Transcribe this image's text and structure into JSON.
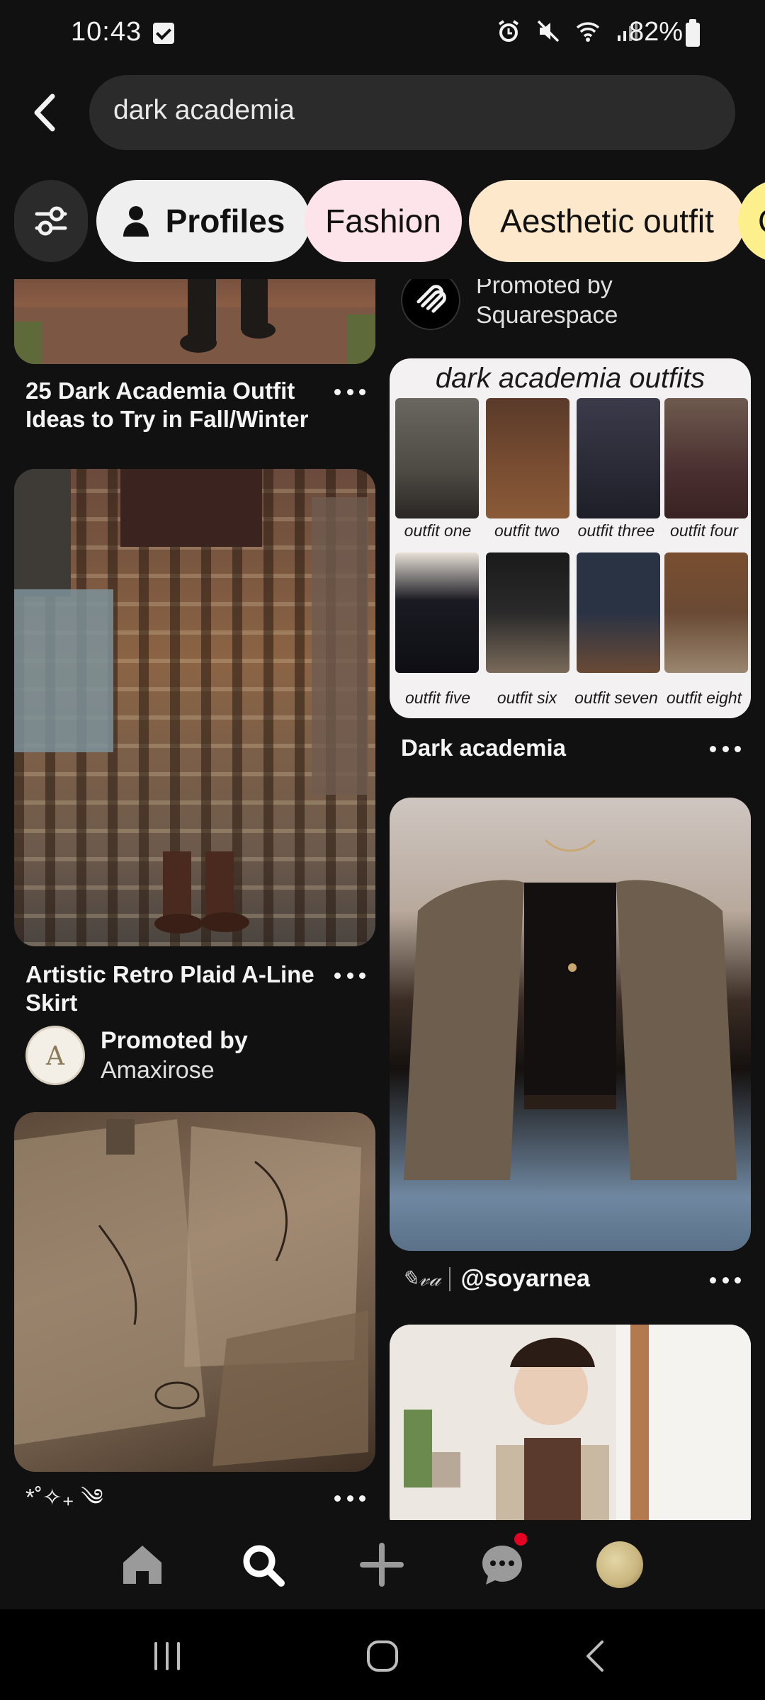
{
  "status_bar": {
    "time": "10:43",
    "battery": "82%",
    "icons": [
      "checkbox-icon",
      "alarm-icon",
      "mute-icon",
      "wifi-icon",
      "signal-icon",
      "battery-icon"
    ]
  },
  "search": {
    "query": "dark academia"
  },
  "chips": [
    {
      "label": "Profiles",
      "color": "#efefef"
    },
    {
      "label": "Fashion",
      "color": "#fde4ea"
    },
    {
      "label": "Aesthetic outfit",
      "color": "#fde8cc"
    },
    {
      "label": "C",
      "color": "#fdf08c"
    }
  ],
  "left_column": {
    "card1": {
      "title_line1": "25 Dark Academia Outfit",
      "title_line2": "Ideas to Try in Fall/Winter"
    },
    "card2": {
      "title_line1": "Artistic Retro Plaid A-Line",
      "title_line2": "Skirt",
      "promoted_by": "Promoted by",
      "advertiser": "Amaxirose"
    },
    "card3": {
      "title": "*˚✧₊ ༄"
    }
  },
  "right_column": {
    "promo_top": {
      "promoted_by": "Promoted by",
      "advertiser": "Squarespace"
    },
    "outfits_card": {
      "image_title": "dark academia outfits",
      "outfit_labels": [
        "outfit one",
        "outfit two",
        "outfit three",
        "outfit four",
        "outfit five",
        "outfit six",
        "outfit seven",
        "outfit eight"
      ],
      "title": "Dark academia"
    },
    "blazer_card": {
      "signature": "✎𝓋𝒶",
      "creator": "@soyarnea"
    }
  },
  "colors": {
    "background": "#111111",
    "notification_badge": "#e60023"
  }
}
